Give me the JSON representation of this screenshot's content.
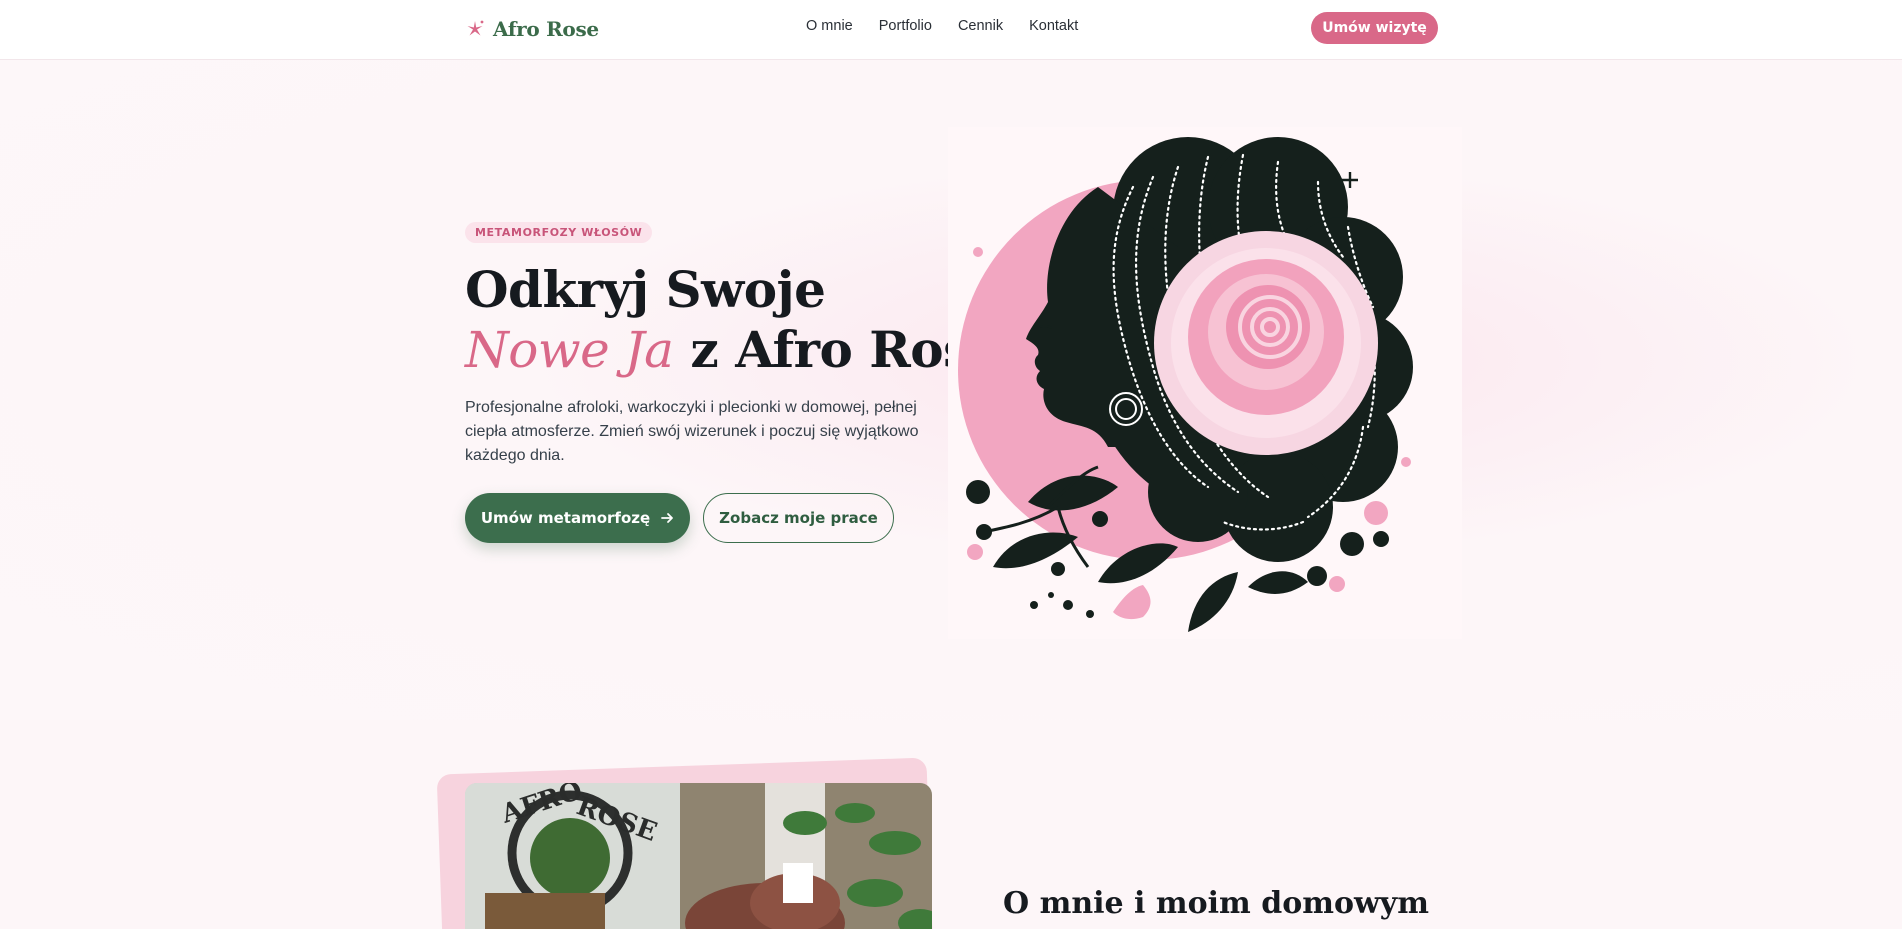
{
  "nav": {
    "logo_text": "Afro Rose",
    "links": [
      "O mnie",
      "Portfolio",
      "Cennik",
      "Kontakt"
    ],
    "cta_label": "Umów wizytę"
  },
  "hero": {
    "badge": "METAMORFOZY WŁOSÓW",
    "title_line1": "Odkryj Swoje",
    "title_accent": "Nowe Ja",
    "title_line2_rest": " z Afro Rose",
    "lead": "Profesjonalne afroloki, warkoczyki i plecionki w domowej, pełnej ciepła atmosferze. Zmień swój wizerunek i poczuj się wyjątkowo każdego dnia.",
    "primary_button": "Umów metamorfozę",
    "secondary_button": "Zobacz moje prace"
  },
  "about": {
    "title": "O mnie i moim domowym"
  },
  "colors": {
    "accent_pink": "#d96888",
    "brand_green": "#3c6e4d",
    "dark": "#161a1f",
    "background": "#fdf6f8"
  },
  "icons": {
    "logo": "flower-sparkle-icon",
    "button_arrow": "arrow-right-icon"
  }
}
